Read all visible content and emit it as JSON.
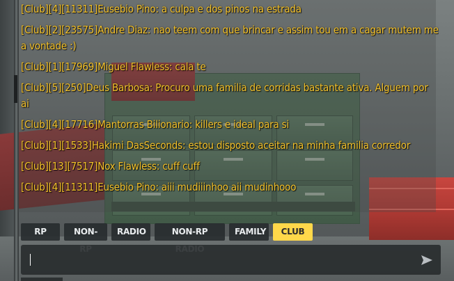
{
  "chat": {
    "messages": [
      "[Club][4][11311]Eusebio Pino: a culpa e dos pinos na estrada",
      "[Club][2][23575]Andre Diaz: nao teem com que brincar e assim tou em a cagar mutem me a vontade :)",
      "[Club][1][17969]Miguel Flawless: cala te",
      "[Club][5][250]Deus Barbosa: Procuro uma familia de corridas bastante ativa. Alguem por ai",
      "[Club][4][17716]Mantorras Bilionario: killers e ideal para si",
      "[Club][1][1533]Hakimi DasSeconds: estou disposto aceitar na minha familia corredor",
      "[Club][13][7517]Nox Flawless: cuff cuff",
      "[Club][4][11311]Eusebio Pino: aiii mudiiinhoo aii mudinhooo"
    ],
    "text_color": "#f3c12a"
  },
  "tabs": [
    {
      "label": "RP",
      "active": false
    },
    {
      "label": "NON-RP",
      "active": false
    },
    {
      "label": "RADIO",
      "active": false
    },
    {
      "label": "NON-RP RADIO",
      "active": false
    },
    {
      "label": "FAMILY",
      "active": false
    },
    {
      "label": "CLUB",
      "active": true
    }
  ],
  "input": {
    "value": "",
    "placeholder": ""
  },
  "icons": {
    "send": "send-arrow-icon"
  },
  "colors": {
    "active_tab": "#ffd84a",
    "tab_bg": "#262a2c"
  }
}
